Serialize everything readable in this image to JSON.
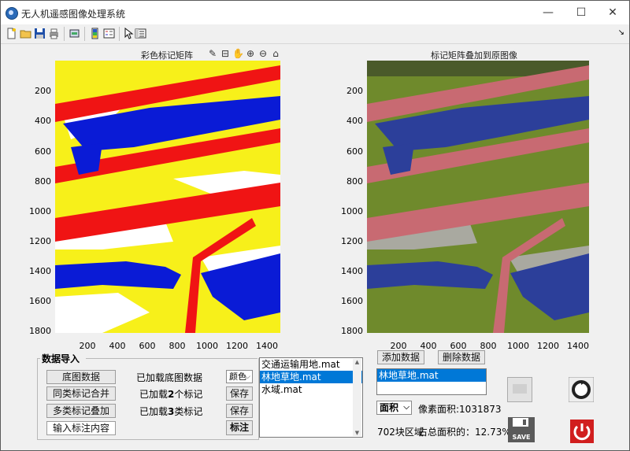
{
  "window": {
    "title": "无人机遥感图像处理系统",
    "controls": {
      "minimize": "—",
      "maximize": "☐",
      "close": "✕"
    }
  },
  "toolbar": {
    "icons": [
      "new-file-icon",
      "open-folder-icon",
      "save-icon",
      "print-icon",
      "print-preview-icon",
      "insert-colorbar-icon",
      "insert-legend-icon",
      "pointer-icon",
      "property-inspector-icon"
    ],
    "dock_arrow": "↘"
  },
  "left_axes": {
    "title": "彩色标记矩阵",
    "yticks": [
      "200",
      "400",
      "600",
      "800",
      "1000",
      "1200",
      "1400",
      "1600",
      "1800"
    ],
    "xticks": [
      "200",
      "400",
      "600",
      "800",
      "1000",
      "1200",
      "1400"
    ],
    "colors": {
      "background": "#f7f01a",
      "road": "#f01414",
      "water": "#0a1bd6",
      "other": "#ffffff"
    }
  },
  "right_axes": {
    "title": "标记矩阵叠加到原图像",
    "yticks": [
      "200",
      "400",
      "600",
      "800",
      "1000",
      "1200",
      "1400",
      "1600",
      "1800"
    ],
    "xticks": [
      "200",
      "400",
      "600",
      "800",
      "1000",
      "1200",
      "1400"
    ],
    "colors": {
      "vegetation": "#6f8a2c",
      "road": "#c86a72",
      "water": "#2c3f9a",
      "bare": "#a9a9a0"
    }
  },
  "data_import": {
    "group_title": "数据导入",
    "base_button": "底图数据",
    "base_status": "已加载底图数据",
    "merge_button": "同类标记合并",
    "merge_status_prefix": "已加载",
    "merge_count": "2",
    "merge_status_suffix": "个标记",
    "overlay_button": "多类标记叠加",
    "overlay_status_prefix": "已加载",
    "overlay_count": "3",
    "overlay_status_suffix": "类标记",
    "input_label_button": "输入标注内容",
    "color_combo": "颜色",
    "save1": "保存",
    "save2": "保存",
    "annotate": "标注"
  },
  "class_list": {
    "items": [
      "交通运输用地.mat",
      "林地草地.mat",
      "水域.mat"
    ],
    "selected": 1
  },
  "right_controls": {
    "add_button": "添加数据",
    "delete_button": "删除数据",
    "data_list": [
      "林地草地.mat"
    ],
    "metric_combo": "面积",
    "pixel_area": "像素面积:1031873",
    "region_count": "702块区域",
    "ratio": "占总面积的：12.73%",
    "save_label": "SAVE"
  }
}
